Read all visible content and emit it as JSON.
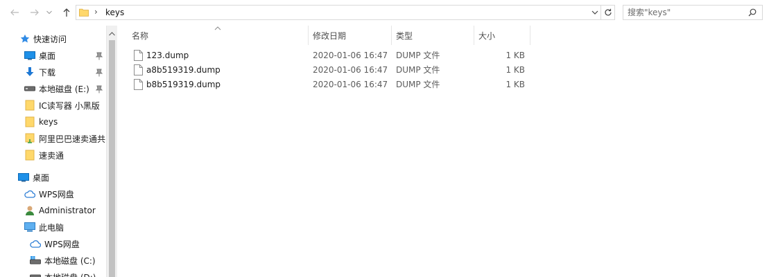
{
  "address_bar": {
    "path": [
      "keys"
    ],
    "separator": "›"
  },
  "search": {
    "placeholder": "搜索\"keys\""
  },
  "sidebar": {
    "quick_access": {
      "label": "快速访问",
      "items": [
        {
          "label": "桌面",
          "icon": "desktop-icon",
          "pinned": true
        },
        {
          "label": "下载",
          "icon": "download-icon",
          "pinned": true
        },
        {
          "label": "本地磁盘 (E:)",
          "icon": "drive-icon",
          "pinned": true
        },
        {
          "label": "IC读写器 小黑版",
          "icon": "folder-icon",
          "pinned": false
        },
        {
          "label": "keys",
          "icon": "folder-icon",
          "pinned": false
        },
        {
          "label": "阿里巴巴速卖通共",
          "icon": "shared-folder-icon",
          "pinned": false
        },
        {
          "label": "速卖通",
          "icon": "folder-icon",
          "pinned": false
        }
      ]
    },
    "desktop": {
      "label": "桌面"
    },
    "tree": [
      {
        "label": "WPS网盘",
        "icon": "cloud-icon"
      },
      {
        "label": "Administrator",
        "icon": "user-icon"
      },
      {
        "label": "此电脑",
        "icon": "computer-icon"
      },
      {
        "label": "WPS网盘",
        "icon": "cloud-icon"
      },
      {
        "label": "本地磁盘 (C:)",
        "icon": "windows-drive-icon"
      },
      {
        "label": "本地磁盘 (D:)",
        "icon": "drive-icon"
      }
    ]
  },
  "file_list": {
    "columns": [
      "名称",
      "修改日期",
      "类型",
      "大小"
    ],
    "rows": [
      {
        "name": "123.dump",
        "modified": "2020-01-06 16:47",
        "type": "DUMP 文件",
        "size": "1 KB"
      },
      {
        "name": "a8b519319.dump",
        "modified": "2020-01-06 16:47",
        "type": "DUMP 文件",
        "size": "1 KB"
      },
      {
        "name": "b8b519319.dump",
        "modified": "2020-01-06 16:47",
        "type": "DUMP 文件",
        "size": "1 KB"
      }
    ]
  },
  "colors": {
    "folder": "#ffd86b",
    "accent": "#0078d7",
    "pin": "#7a7a7a"
  }
}
